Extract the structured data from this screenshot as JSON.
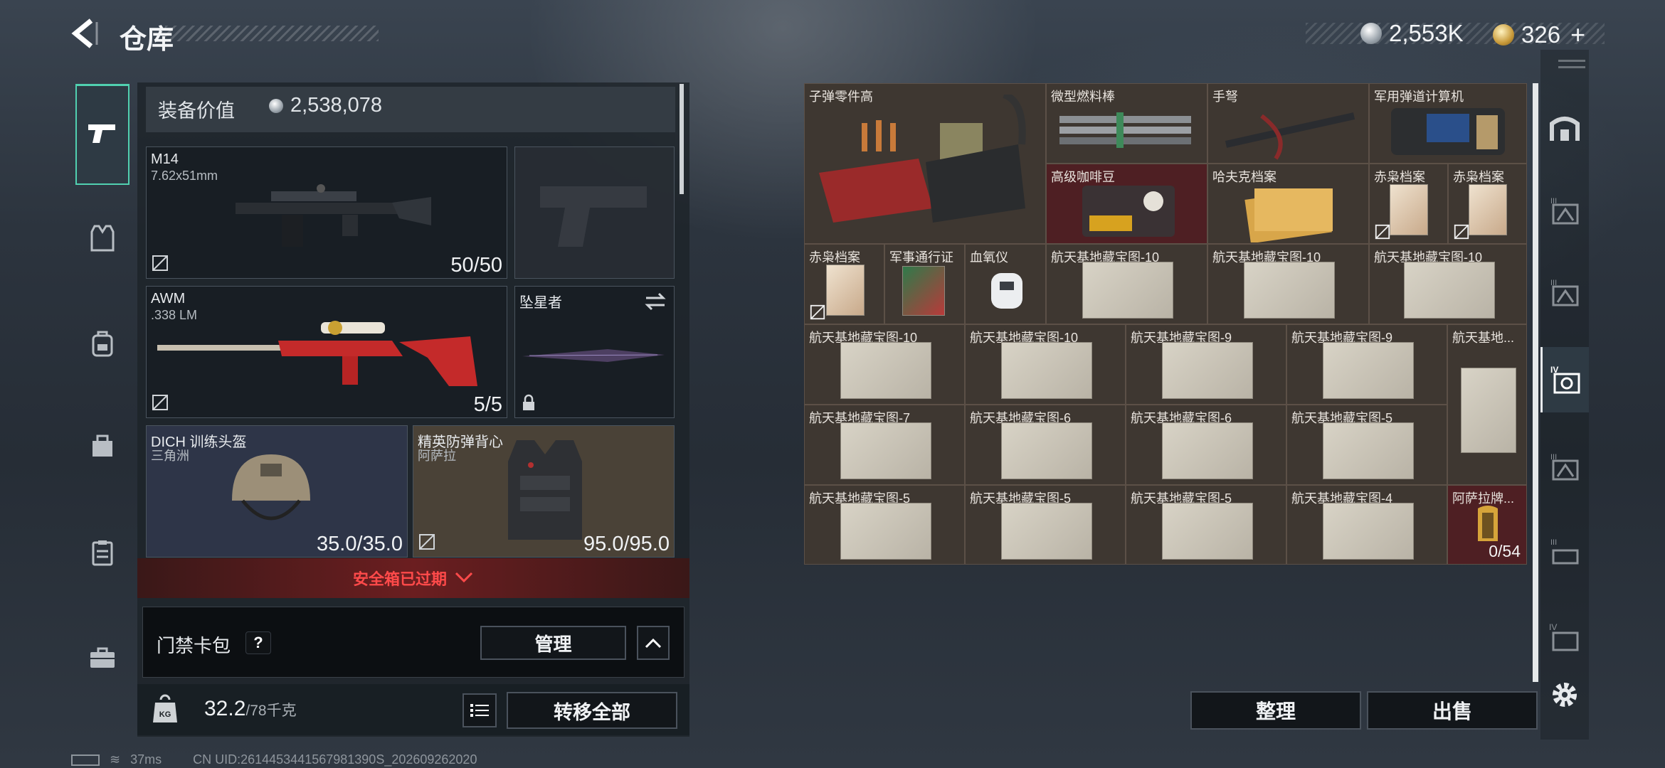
{
  "header": {
    "title": "仓库"
  },
  "currency": {
    "silver": "2,553K",
    "gold": "326"
  },
  "equipment": {
    "label": "装备价值",
    "value": "2,538,078",
    "primary": {
      "name": "M14",
      "caliber": "7.62x51mm",
      "ammo": "50/50"
    },
    "secondary": {
      "name": "AWM",
      "caliber": ".338 LM",
      "ammo": "5/5"
    },
    "melee": {
      "name": "坠星者"
    },
    "helmet": {
      "name": "DICH 训练头盔",
      "origin": "三角洲",
      "durability": "35.0/35.0"
    },
    "armor": {
      "name": "精英防弹背心",
      "origin": "阿萨拉",
      "durability": "95.0/95.0"
    }
  },
  "safe_box": {
    "status": "安全箱已过期"
  },
  "card_bag": {
    "label": "门禁卡包",
    "help": "?",
    "manage": "管理"
  },
  "footer": {
    "weight": "32.2",
    "capacity": "/78千克",
    "transfer_all": "转移全部"
  },
  "stash": {
    "items": [
      {
        "label": "子弹零件高"
      },
      {
        "label": "微型燃料棒"
      },
      {
        "label": "手弩"
      },
      {
        "label": "军用弹道计算机"
      },
      {
        "label": "高级咖啡豆"
      },
      {
        "label": "哈夫克档案"
      },
      {
        "label": "赤枭档案"
      },
      {
        "label": "赤枭档案"
      },
      {
        "label": "赤枭档案"
      },
      {
        "label": "军事通行证"
      },
      {
        "label": "血氧仪"
      },
      {
        "label": "航天基地藏宝图-10"
      },
      {
        "label": "航天基地藏宝图-10"
      },
      {
        "label": "航天基地藏宝图-10"
      },
      {
        "label": "航天基地藏宝图-10"
      },
      {
        "label": "航天基地藏宝图-10"
      },
      {
        "label": "航天基地藏宝图-9"
      },
      {
        "label": "航天基地藏宝图-9"
      },
      {
        "label": "航天基地..."
      },
      {
        "label": "航天基地藏宝图-7"
      },
      {
        "label": "航天基地藏宝图-6"
      },
      {
        "label": "航天基地藏宝图-6"
      },
      {
        "label": "航天基地藏宝图-5"
      },
      {
        "label": "航天基地藏宝图-5"
      },
      {
        "label": "航天基地藏宝图-5"
      },
      {
        "label": "航天基地藏宝图-5"
      },
      {
        "label": "航天基地藏宝图-4"
      },
      {
        "label": "阿萨拉牌...",
        "count": "0/54"
      }
    ],
    "sort": "整理",
    "sell": "出售"
  },
  "status": {
    "ping": "37ms",
    "uid": "CN UID:2614453441567981390S_202609262020"
  }
}
